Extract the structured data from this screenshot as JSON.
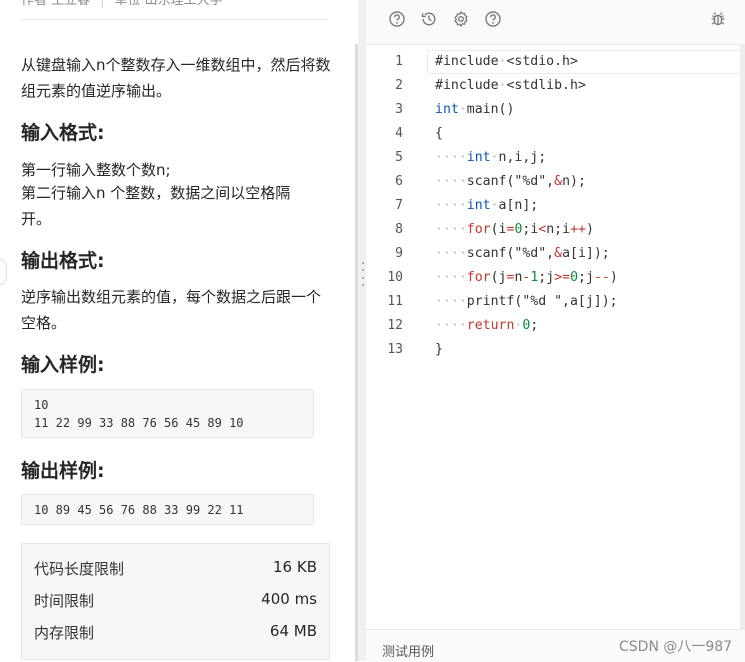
{
  "problem": {
    "author_label": "作者 王立春",
    "unit_label": "单位 山东理工大学",
    "description": "从键盘输入n个整数存入一维数组中，然后将数组元素的值逆序输出。",
    "input_format_title": "输入格式:",
    "input_format_line1": "第一行输入整数个数n;",
    "input_format_line2": "第二行输入n 个整数，数据之间以空格隔开。",
    "output_format_title": "输出格式:",
    "output_format_text": "逆序输出数组元素的值，每个数据之后跟一个空格。",
    "sample_input_title": "输入样例:",
    "sample_input_lines": [
      "10",
      "11 22 99 33 88 76 56 45 89 10"
    ],
    "sample_output_title": "输出样例:",
    "sample_output_lines": [
      "10 89 45 56 76 88 33 99 22 11"
    ],
    "limits": [
      {
        "label": "代码长度限制",
        "value": "16 KB"
      },
      {
        "label": "时间限制",
        "value": "400 ms"
      },
      {
        "label": "内存限制",
        "value": "64 MB"
      }
    ]
  },
  "toolbar": {
    "icons": [
      "help-circle-icon",
      "history-icon",
      "settings-gear-icon",
      "question-icon",
      "bug-icon"
    ]
  },
  "editor": {
    "line_numbers": [
      "1",
      "2",
      "3",
      "4",
      "5",
      "6",
      "7",
      "8",
      "9",
      "10",
      "11",
      "12",
      "13"
    ],
    "lines": [
      "#include <stdio.h>",
      "#include <stdlib.h>",
      "int main()",
      "{",
      "    int n,i,j;",
      "    scanf(\"%d\",&n);",
      "    int a[n];",
      "    for(i=0;i<n;i++)",
      "    scanf(\"%d\",&a[i]);",
      "    for(j=n-1;j>=0;j--)",
      "    printf(\"%d \",a[j]);",
      "    return 0;",
      "}"
    ]
  },
  "bottombar": {
    "testcase_label": "测试用例",
    "watermark": "CSDN @八一987"
  },
  "colors": {
    "keyword": "#0b55b8",
    "control": "#c0392b",
    "number": "#0b8a3a",
    "whitespace_dot": "#b8b8b8"
  }
}
